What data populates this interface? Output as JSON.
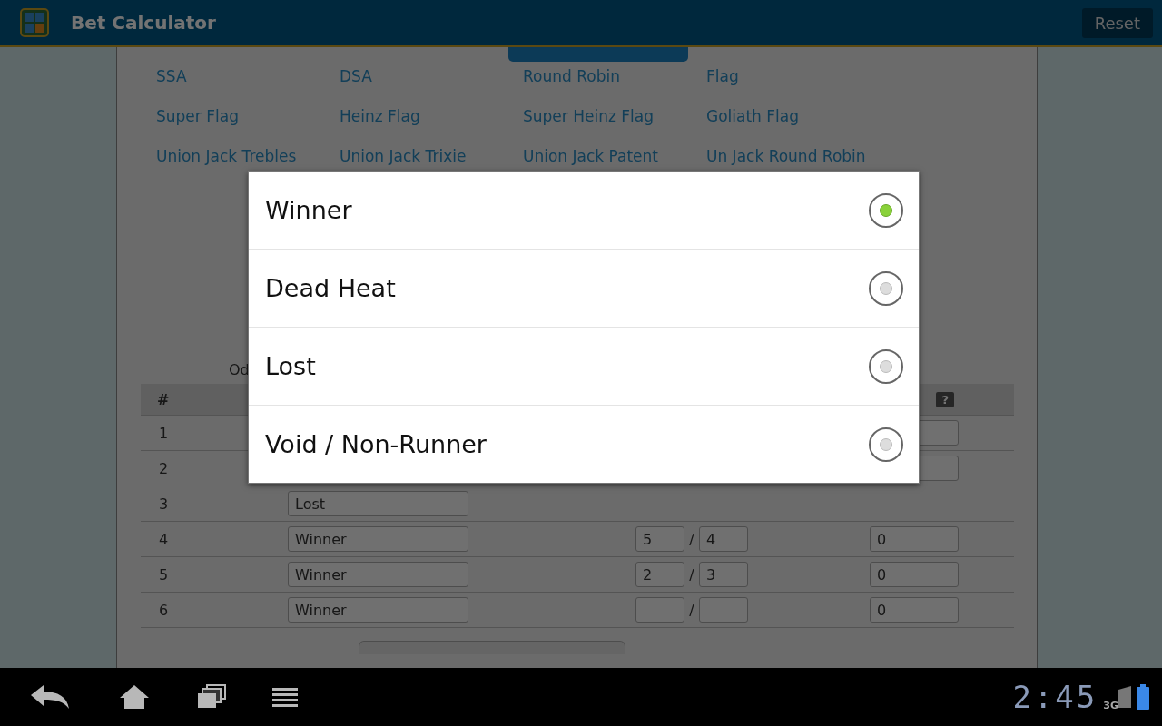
{
  "app_bar": {
    "title": "Bet Calculator",
    "reset_button": "Reset"
  },
  "bet_types": [
    "SSA",
    "DSA",
    "Round Robin",
    "Flag",
    "Super Flag",
    "Heinz Flag",
    "Super Heinz Flag",
    "Goliath Flag",
    "Union Jack Trebles",
    "Union Jack Trixie",
    "Union Jack Patent",
    "Un Jack Round Robin"
  ],
  "odds_label": "Od",
  "table": {
    "columns": [
      {
        "label": "#"
      }
    ],
    "help_badge": "?",
    "rows": [
      {
        "number": "1",
        "kind": "odds",
        "odds": {}
      },
      {
        "number": "2",
        "kind": "odds",
        "odds": {}
      },
      {
        "number": "3",
        "kind": "plain",
        "result": "Lost"
      },
      {
        "number": "4",
        "kind": "odds",
        "result": "Winner",
        "odds": {
          "num": "5",
          "sep": "/",
          "den": "4"
        },
        "column_4": "0"
      },
      {
        "number": "5",
        "kind": "odds",
        "result": "Winner",
        "odds": {
          "num": "2",
          "sep": "/",
          "den": "3"
        },
        "column_4": "0"
      },
      {
        "number": "6",
        "kind": "odds",
        "result": "Winner",
        "odds": {
          "sep": "/"
        },
        "column_4": "0"
      }
    ]
  },
  "result_dialog": {
    "options": [
      {
        "label": "Winner",
        "selected": true
      },
      {
        "label": "Dead Heat",
        "selected": false
      },
      {
        "label": "Lost",
        "selected": false
      },
      {
        "label": "Void / Non-Runner",
        "selected": false
      }
    ]
  },
  "nav_bar": {
    "clock": "2:45",
    "network": "3G"
  }
}
